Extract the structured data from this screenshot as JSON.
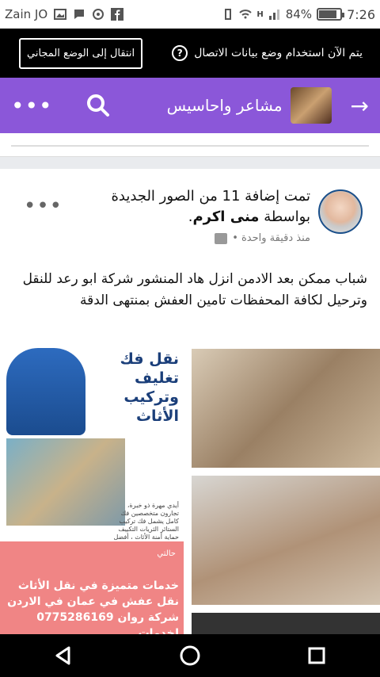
{
  "status_bar": {
    "carrier": "Zain JO",
    "battery_percent": "84%",
    "battery_level": 0.84,
    "time": "7:26",
    "network_type": "H"
  },
  "data_banner": {
    "message": "يتم الآن استخدام وضع بيانات الاتصال",
    "free_mode_button": "انتقال إلى الوضع المجاني",
    "help_icon": "?"
  },
  "top_bar": {
    "title": "مشاعر واحاسيس",
    "back_icon": "→",
    "search_icon": "search-icon",
    "more_icon": "•••"
  },
  "post": {
    "title_prefix": "تمت إضافة 11 من الصور الجديدة بواسطة",
    "author": "منى اكرم",
    "title_suffix": ".",
    "meta": "منذ دقيقة واحدة •",
    "menu": "•••",
    "body": "شباب ممكن بعد الادمن انزل هاد المنشور شركة ابو رعد للنقل وترحيل لكافة المحفظات  تامين العفش بمنتهى الدقة",
    "image_a_caption": "نقل فك تغليف وتركيب الأثاث",
    "image_a_small": "أيدي مهرة ذو خبرة، تجارون متخصصين فك كامل يشمل فك تركيب الستائر الثريات التكييف حماية أمنة الأثاث ، أفضل مواد التغليف",
    "image_b_profile": "حالتي",
    "image_b_text": "خدمات متميزة في نقل الأثاث نقل عفش في عمان في الاردن شركة روان 0775286169 لخدمات"
  },
  "nav": {
    "back": "back-icon",
    "home": "home-icon",
    "recents": "recents-icon"
  }
}
